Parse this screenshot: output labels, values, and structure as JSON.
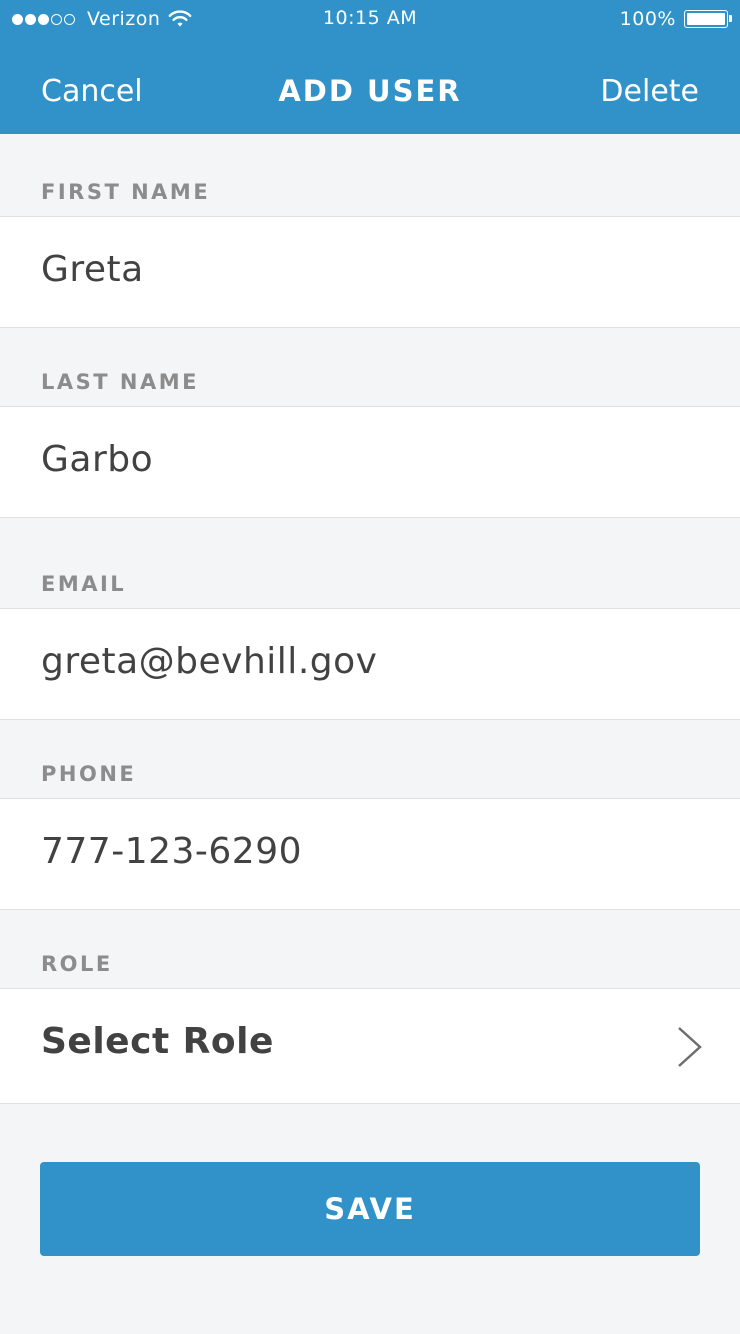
{
  "status_bar": {
    "carrier": "Verizon",
    "time": "10:15 AM",
    "battery": "100%",
    "battery_level": 1.0,
    "signal_strength": 3,
    "signal_max": 5,
    "icons": [
      "signal-dots-icon",
      "wifi-icon",
      "battery-icon"
    ]
  },
  "nav": {
    "cancel_label": "Cancel",
    "title": "ADD USER",
    "delete_label": "Delete"
  },
  "form": {
    "first_name": {
      "label": "FIRST NAME",
      "value": "Greta"
    },
    "last_name": {
      "label": "LAST NAME",
      "value": "Garbo"
    },
    "email": {
      "label": "EMAIL",
      "value": "greta@bevhill.gov"
    },
    "phone": {
      "label": "PHONE",
      "value": "777-123-6290"
    },
    "role": {
      "label": "ROLE",
      "value": "Select Role",
      "icon": "chevron-right-icon"
    }
  },
  "actions": {
    "save_label": "SAVE"
  },
  "colors": {
    "accent": "#3092c9",
    "background": "#f4f5f7",
    "field_background": "#ffffff",
    "label": "#8c8c8c",
    "text": "#424242"
  }
}
